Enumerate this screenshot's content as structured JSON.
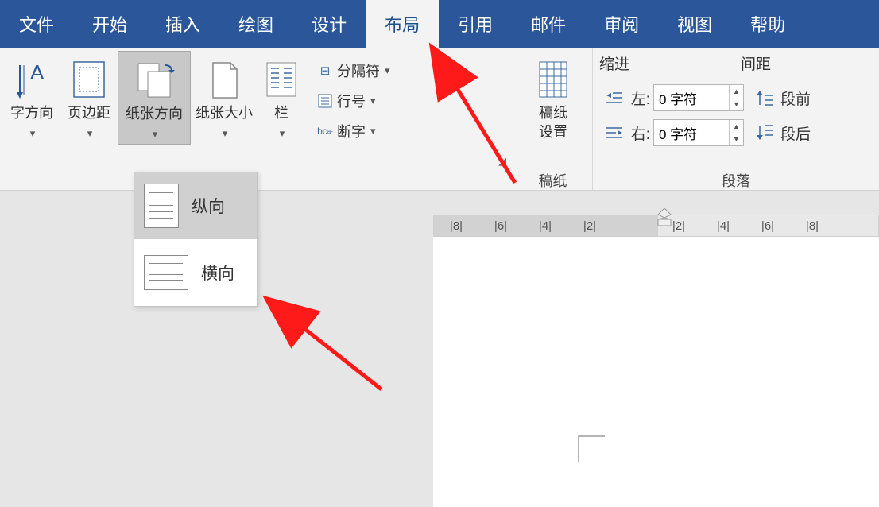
{
  "tabs": [
    "文件",
    "开始",
    "插入",
    "绘图",
    "设计",
    "布局",
    "引用",
    "邮件",
    "审阅",
    "视图",
    "帮助"
  ],
  "active_tab_index": 5,
  "ribbon": {
    "textdir": "字方向",
    "margins": "页边距",
    "orientation": "纸张方向",
    "size": "纸张大小",
    "columns": "栏",
    "breaks": "分隔符",
    "linenum": "行号",
    "hyphen": "断字",
    "manuscript_label": "稿纸",
    "manuscript_sub": "设置",
    "manuscript_group": "稿纸",
    "indent_title": "缩进",
    "spacing_title": "间距",
    "left_label": "左:",
    "right_label": "右:",
    "indent_value": "0 字符",
    "before_label": "段前",
    "after_label": "段后",
    "paragraph_group": "段落"
  },
  "dropdown": {
    "portrait": "纵向",
    "landscape": "横向",
    "selected": "portrait"
  },
  "ruler_marks": [
    "|8|",
    "|6|",
    "|4|",
    "|2|",
    "",
    "|2|",
    "|4|",
    "|6|",
    "|8|"
  ]
}
